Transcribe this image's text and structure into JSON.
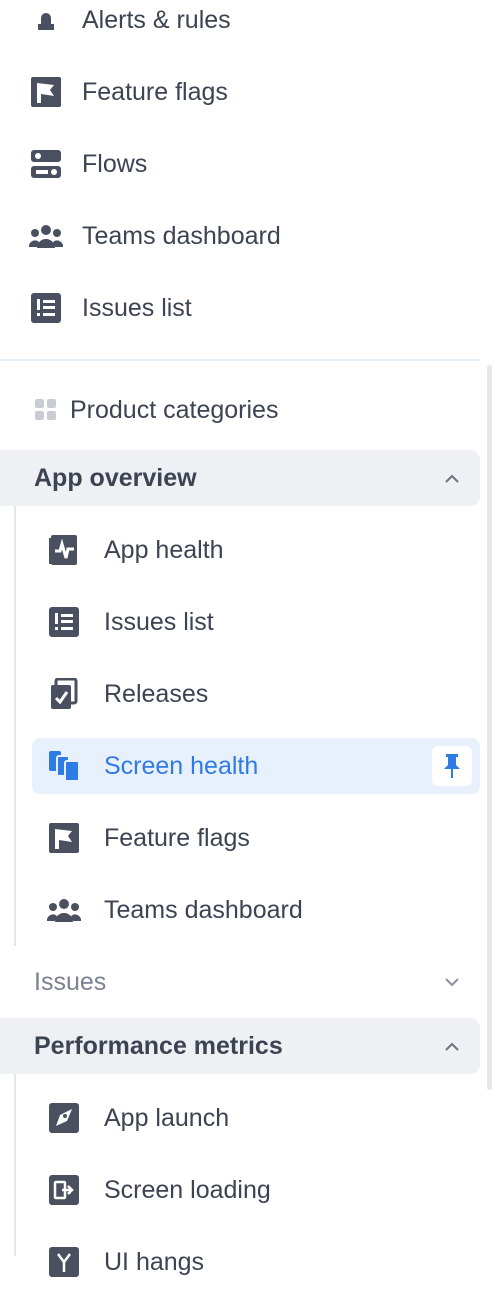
{
  "top_items": [
    {
      "label": "Alerts & rules",
      "icon": "alarm-icon"
    },
    {
      "label": "Feature flags",
      "icon": "flag-icon"
    },
    {
      "label": "Flows",
      "icon": "flows-icon"
    },
    {
      "label": "Teams dashboard",
      "icon": "team-icon"
    },
    {
      "label": "Issues list",
      "icon": "list-icon"
    }
  ],
  "product_categories": {
    "label": "Product categories",
    "icon": "grid-icon"
  },
  "app_overview": {
    "label": "App overview",
    "expanded": true,
    "items": [
      {
        "label": "App health",
        "icon": "pulse-icon"
      },
      {
        "label": "Issues list",
        "icon": "list-icon"
      },
      {
        "label": "Releases",
        "icon": "release-icon"
      },
      {
        "label": "Screen health",
        "icon": "screens-icon",
        "active": true,
        "pinned": true
      },
      {
        "label": "Feature flags",
        "icon": "flag-icon"
      },
      {
        "label": "Teams dashboard",
        "icon": "team-icon"
      }
    ]
  },
  "issues_section": {
    "label": "Issues",
    "expanded": false
  },
  "performance_metrics": {
    "label": "Performance metrics",
    "expanded": true,
    "items": [
      {
        "label": "App launch",
        "icon": "rocket-icon"
      },
      {
        "label": "Screen loading",
        "icon": "screen-loading-icon"
      },
      {
        "label": "UI hangs",
        "icon": "hang-icon"
      }
    ]
  },
  "colors": {
    "accent": "#2f7be5",
    "active_bg": "#e8f1fb",
    "icon_gray": "#4a5060",
    "section_bg": "#eef0f3"
  }
}
